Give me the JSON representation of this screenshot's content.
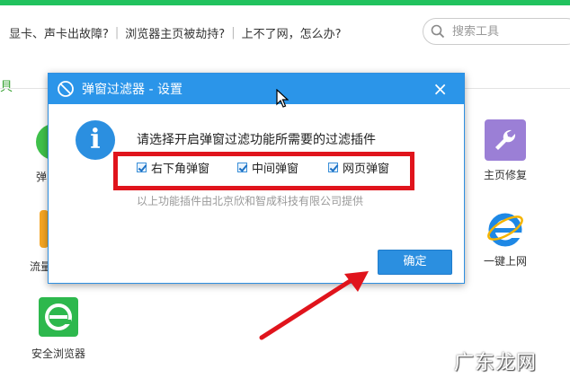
{
  "quick_links": [
    "显卡、声卡出故障?",
    "浏览器主页被劫持?",
    "上不了网，怎么办?"
  ],
  "search": {
    "placeholder": "搜索工具"
  },
  "section": {
    "tools_label": "具"
  },
  "tools": [
    {
      "label": "主页修复",
      "icon": "wrench-icon"
    },
    {
      "label": "一键上网",
      "icon": "ie-icon"
    },
    {
      "label": "安全浏览器",
      "icon": "safe-browser-icon"
    }
  ],
  "left_cut_labels": [
    "弹",
    "流量"
  ],
  "dialog": {
    "title": "弹窗过滤器 - 设置",
    "message": "请选择开启弹窗过滤功能所需要的过滤插件",
    "options": [
      {
        "label": "右下角弹窗",
        "checked": true
      },
      {
        "label": "中间弹窗",
        "checked": true
      },
      {
        "label": "网页弹窗",
        "checked": true
      }
    ],
    "note": "以上功能插件由北京欣和智成科技有限公司提供",
    "ok_label": "确定",
    "close_glyph": "×",
    "info_glyph": "i"
  },
  "colors": {
    "accent_green": "#21c25e",
    "dialog_blue": "#2b95e9",
    "highlight_red": "#e0141c"
  },
  "watermark": "广东龙网"
}
